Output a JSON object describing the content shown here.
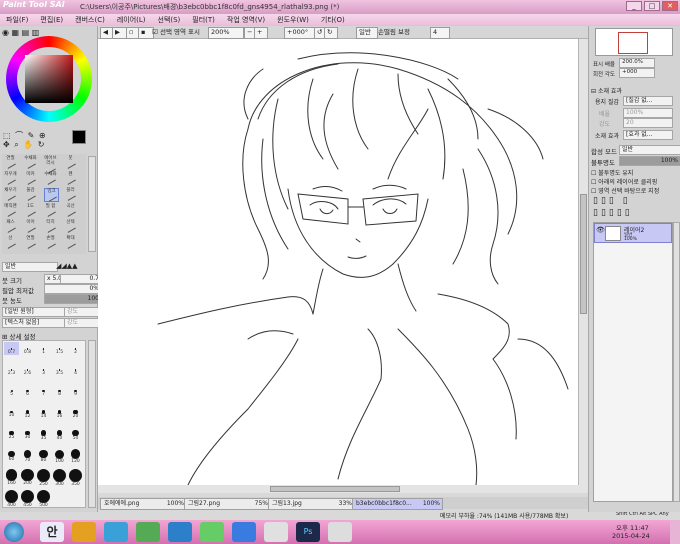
{
  "window": {
    "app_logo": "Paint Tool SAI",
    "path": "C:\\Users\\이공주\\Pictures\\배경\\b3ebc0bbc1f8c0fd_gns4954_rlathal93.png (*)",
    "controls": [
      "_",
      "□",
      "✕"
    ]
  },
  "menu": [
    "파일(F)",
    "편집(E)",
    "캔버스(C)",
    "레이어(L)",
    "선택(S)",
    "필터(T)",
    "작업 영역(V)",
    "윈도우(W)",
    "기타(O)"
  ],
  "toolbar": {
    "selection_label": "선택 영역 표시",
    "zoom": "200%",
    "rotation": "+000°",
    "mode": "일반",
    "stabilizer_label": "손떨림 보정",
    "stabilizer_value": "4"
  },
  "left": {
    "tools": [
      [
        "연필",
        "수채화",
        "에어브러시",
        "붓"
      ],
      [
        "지우개",
        "마커",
        "수채화",
        "펜"
      ],
      [
        "채우기",
        "물감",
        "잉크",
        "블러"
      ],
      [
        "매직펜",
        "1도",
        "필 합",
        "곡선"
      ],
      [
        "패스",
        "이어",
        "터치",
        "선택"
      ],
      [
        "선",
        "연필",
        "손떨",
        "확대"
      ]
    ],
    "mode_label": "일반",
    "brush_size_label": "붓 크기",
    "brush_size_mult": "x 5.0",
    "brush_size_value": "0.7",
    "min_size_label": "필압 최저값",
    "min_size_value": "0%",
    "density_label": "붓 농도",
    "density_value": "100",
    "shape_label": "[일반 원형]",
    "shape_value": "강도",
    "texture_label": "[텍스처 없음]",
    "texture_value": "강도",
    "advanced_label": "상세 설정",
    "brush_sizes": [
      "0.7",
      "0.8",
      "1",
      "1.5",
      "2",
      "2.3",
      "2.6",
      "3",
      "3.5",
      "4",
      "5",
      "6",
      "7",
      "8",
      "9",
      "10",
      "12",
      "14",
      "16",
      "20",
      "25",
      "30",
      "35",
      "40",
      "50",
      "60",
      "70",
      "80",
      "100",
      "120",
      "160",
      "200",
      "250",
      "300",
      "350",
      "400",
      "450",
      "500"
    ]
  },
  "right": {
    "nav_zoom_label": "표시 배율",
    "nav_zoom_value": "200.0%",
    "nav_rot_label": "회전 각도",
    "nav_rot_value": "+000",
    "paper_effect_label": "소재 효과",
    "paper_texture_label": "용지 질감",
    "paper_texture_value": "[질감 없...",
    "scale_label": "배율",
    "scale_value": "100%",
    "strength_label": "강도",
    "strength_value": "20",
    "effect_label": "소재 효과",
    "effect_value": "[효과 없...",
    "blend_label": "합성 모드",
    "blend_value": "일반",
    "opacity_label": "불투명도",
    "opacity_value": "100%",
    "checks": [
      "불투명도 유지",
      "아래의 레이어로 클리핑",
      "영역 선택 바탕으로 지정"
    ],
    "layer_name": "레이어2",
    "layer_mode": "일반",
    "layer_opacity": "100%"
  },
  "tabs": [
    {
      "name": "호에에에.png",
      "pct": "100%"
    },
    {
      "name": "그림27.png",
      "pct": "75%"
    },
    {
      "name": "그림13.jpg",
      "pct": "33%"
    },
    {
      "name": "b3ebc0bbc1f8c0...",
      "pct": "100%"
    }
  ],
  "status": {
    "memory": "메모리 부하율 :74% (141MB 사용/778MB 확보)",
    "keys": [
      "Shift",
      "Ctrl",
      "Alt",
      "SPC",
      "Any"
    ]
  },
  "taskbar": {
    "time_label": "오후 11:47",
    "date": "2015-04-24",
    "input_lang": "안"
  },
  "colors": {
    "accent": "#d471b0",
    "selected_layer": "#c8c8f4",
    "canvas": "#ffffff"
  }
}
